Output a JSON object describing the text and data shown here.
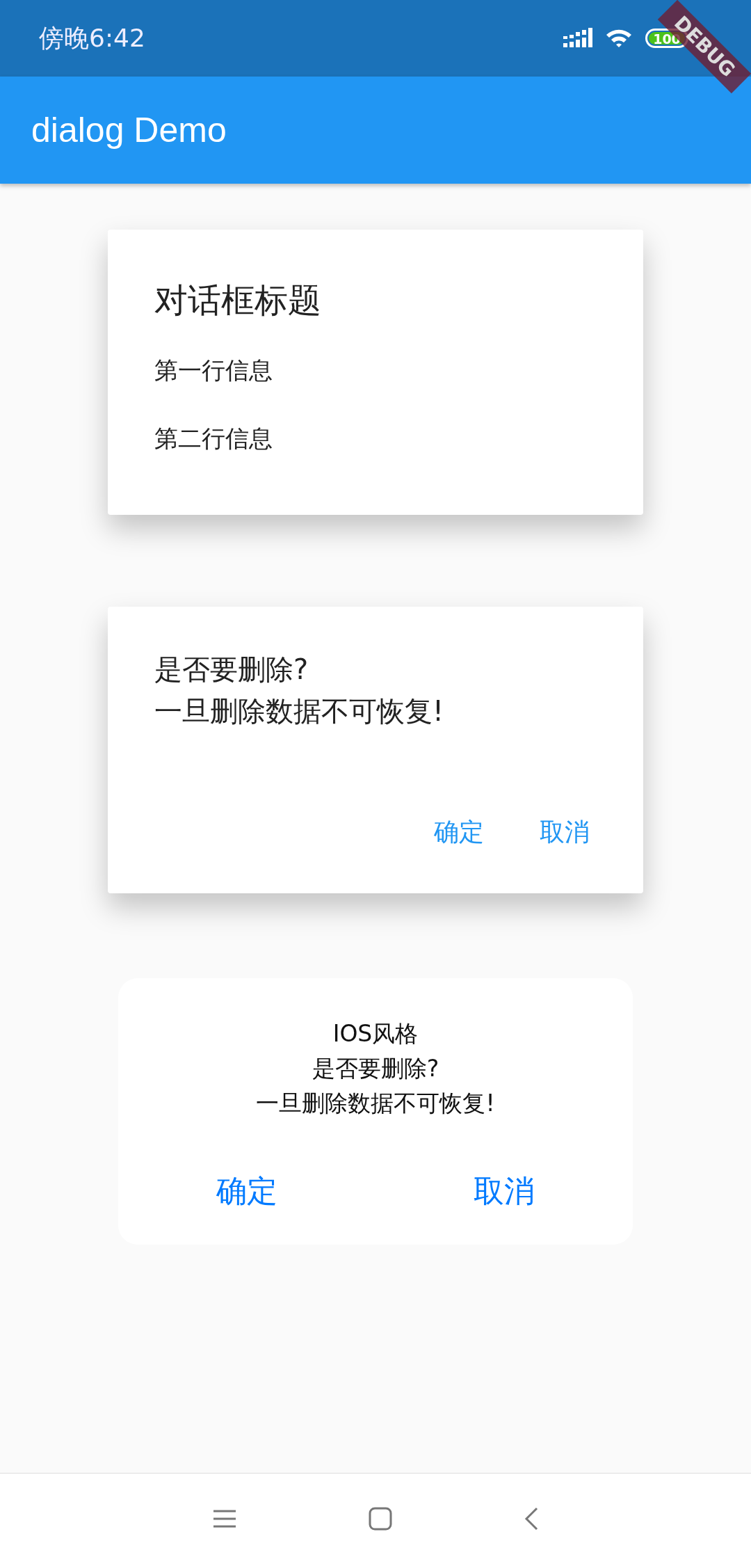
{
  "status_bar": {
    "time": "傍晚6:42",
    "battery": "100"
  },
  "debug_banner": "DEBUG",
  "app_bar": {
    "title": "dialog Demo"
  },
  "simple_dialog": {
    "title": "对话框标题",
    "options": [
      "第一行信息",
      "第二行信息"
    ]
  },
  "alert_dialog": {
    "content": [
      "是否要删除?",
      "一旦删除数据不可恢复!"
    ],
    "actions": [
      "确定",
      "取消"
    ]
  },
  "cupertino_dialog": {
    "content": [
      "IOS风格",
      "是否要删除?",
      "一旦删除数据不可恢复!"
    ],
    "actions": [
      "确定",
      "取消"
    ]
  }
}
